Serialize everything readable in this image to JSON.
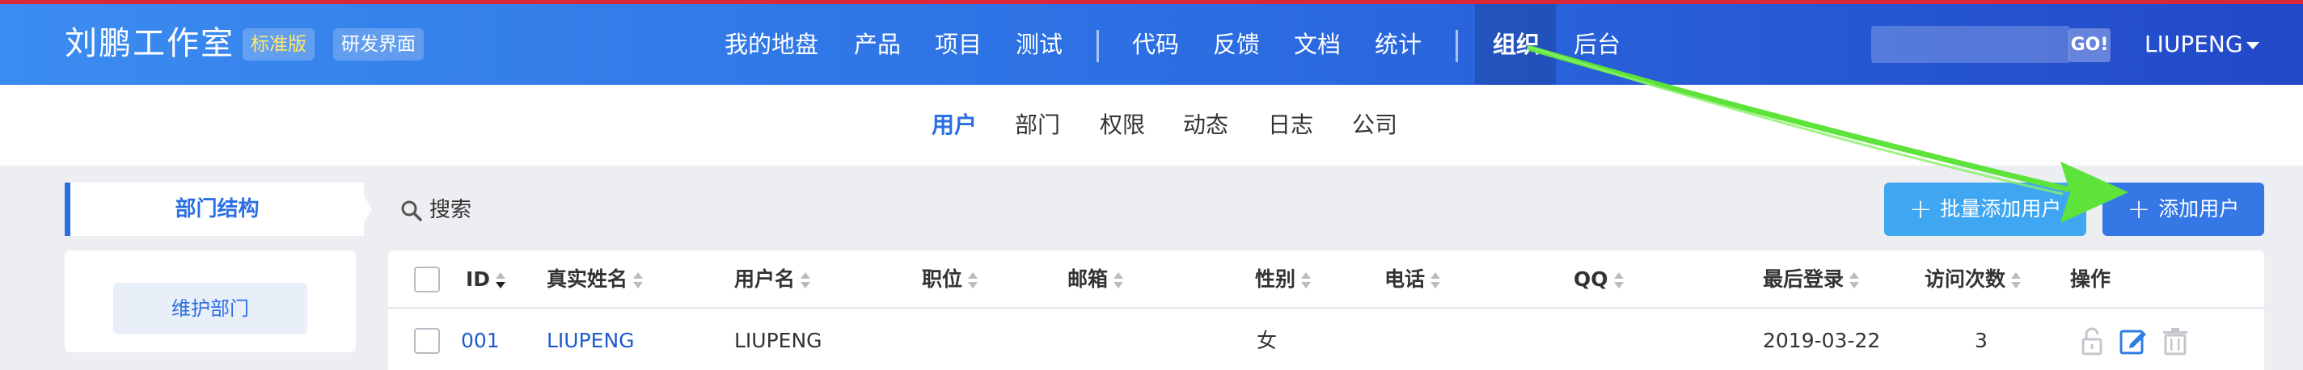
{
  "header": {
    "brand": "刘鹏工作室",
    "edition_badge": "标准版",
    "mode_badge": "研发界面",
    "nav": [
      "我的地盘",
      "产品",
      "项目",
      "测试",
      "代码",
      "反馈",
      "文档",
      "统计",
      "组织",
      "后台"
    ],
    "active_nav": "组织",
    "search_placeholder": "",
    "search_go": "GO!",
    "user": "LIUPENG"
  },
  "subnav": {
    "items": [
      "用户",
      "部门",
      "权限",
      "动态",
      "日志",
      "公司"
    ],
    "active": "用户"
  },
  "sidebar": {
    "tab_label": "部门结构",
    "maintain_button": "维护部门"
  },
  "toolbar": {
    "search_label": "搜索",
    "batch_add_label": "批量添加用户",
    "add_label": "添加用户"
  },
  "table": {
    "columns": [
      "ID",
      "真实姓名",
      "用户名",
      "职位",
      "邮箱",
      "性别",
      "电话",
      "QQ",
      "最后登录",
      "访问次数",
      "操作"
    ],
    "rows": [
      {
        "id": "001",
        "realname": "LIUPENG",
        "username": "LIUPENG",
        "position": "",
        "email": "",
        "gender": "女",
        "phone": "",
        "qq": "",
        "last_login": "2019-03-22",
        "visits": "3"
      }
    ]
  },
  "colors": {
    "header_start": "#3b8cf0",
    "header_end": "#2248c8",
    "accent": "#2c6fe3",
    "batch_button": "#3fa7f2",
    "add_button": "#3578e5",
    "annotation_arrow": "#5ee33a"
  },
  "icons": {
    "search": "search-icon",
    "sort": "sort-icon",
    "unlock": "unlock-icon",
    "edit": "edit-icon",
    "delete": "trash-icon",
    "plus": "plus-icon"
  }
}
